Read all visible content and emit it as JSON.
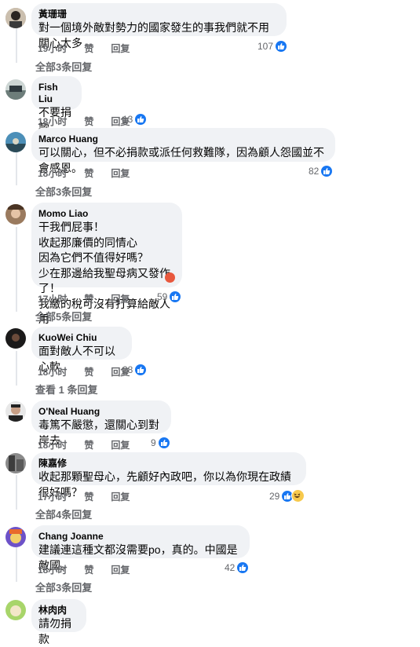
{
  "comments": [
    {
      "name": "黃珊珊",
      "text": "對一個境外敵對勢力的國家發生的事我們就不用關心太多",
      "time": "19小时",
      "like": "赞",
      "reply": "回复",
      "reactions": "107",
      "replies_link": "全部3条回复"
    },
    {
      "name": "Fish Liu",
      "text": "不要捐款",
      "time": "18小时",
      "like": "赞",
      "reply": "回复",
      "reactions": "13"
    },
    {
      "name": "Marco Huang",
      "text": "可以關心，但不必捐款或派任何救難隊，因為顧人怨國並不會感恩。",
      "time": "18小时",
      "like": "赞",
      "reply": "回复",
      "reactions": "82",
      "replies_link": "全部3条回复"
    },
    {
      "name": "Momo Liao",
      "text": "干我們屁事！\n收起那廉價的同情心\n因為它們不值得好嗎？\n少在那邊給我聖母病又發作了！\n我繳的稅可沒有打算給敵人用",
      "time": "17小时",
      "like": "赞",
      "reply": "回复",
      "reactions": "59",
      "replies_link": "全部5条回复"
    },
    {
      "name": "KuoWei Chiu",
      "text": "面對敵人不可以心軟",
      "time": "18小时",
      "like": "赞",
      "reply": "回复",
      "reactions": "28",
      "replies_link": "查看 1 条回复"
    },
    {
      "name": "O'Neal Huang",
      "text": "毒篤不嚴懲，還關心到對岸去",
      "time": "18小时",
      "like": "赞",
      "reply": "回复",
      "reactions": "9"
    },
    {
      "name": "陳嘉修",
      "text": "收起那顆聖母心，先顧好內政吧，你以為你現在政績很好嗎？",
      "time": "17小时",
      "like": "赞",
      "reply": "回复",
      "reactions": "29",
      "replies_link": "全部4条回复"
    },
    {
      "name": "Chang Joanne",
      "text": "建議連這種文都沒需要po，真的。中國是敵國。",
      "time": "18小时",
      "like": "赞",
      "reply": "回复",
      "reactions": "42",
      "replies_link": "全部3条回复"
    },
    {
      "name": "林肉肉",
      "text": "請勿捐款"
    }
  ],
  "colors": {
    "like_blue": "#1877f2",
    "bubble_bg": "#f0f2f5",
    "meta_gray": "#65676b",
    "haha_yellow": "#f7c94c",
    "angry_red": "#e8583d"
  }
}
